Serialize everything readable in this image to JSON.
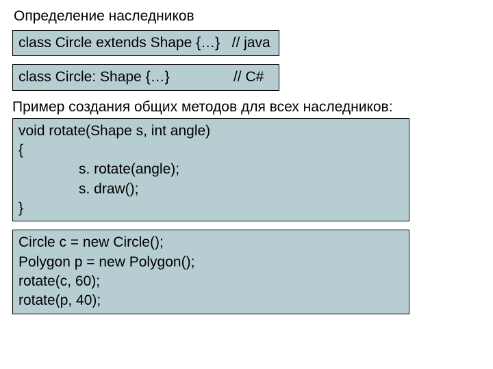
{
  "heading": "Определение наследников",
  "box1": {
    "line": "class Circle extends Shape {…}   // java"
  },
  "box2": {
    "line": "class Circle: Shape {…}                // C#"
  },
  "subheading": "Пример создания общих методов для всех наследников:",
  "box3": {
    "l1": "void rotate(Shape s, int angle)",
    "l2": "{",
    "l3": "s. rotate(angle);",
    "l4": "s. draw();",
    "l5": "}"
  },
  "box4": {
    "l1": "Circle c = new Circle();",
    "l2": "Polygon p = new Polygon();",
    "l3": "rotate(c, 60);",
    "l4": "rotate(p, 40);"
  }
}
